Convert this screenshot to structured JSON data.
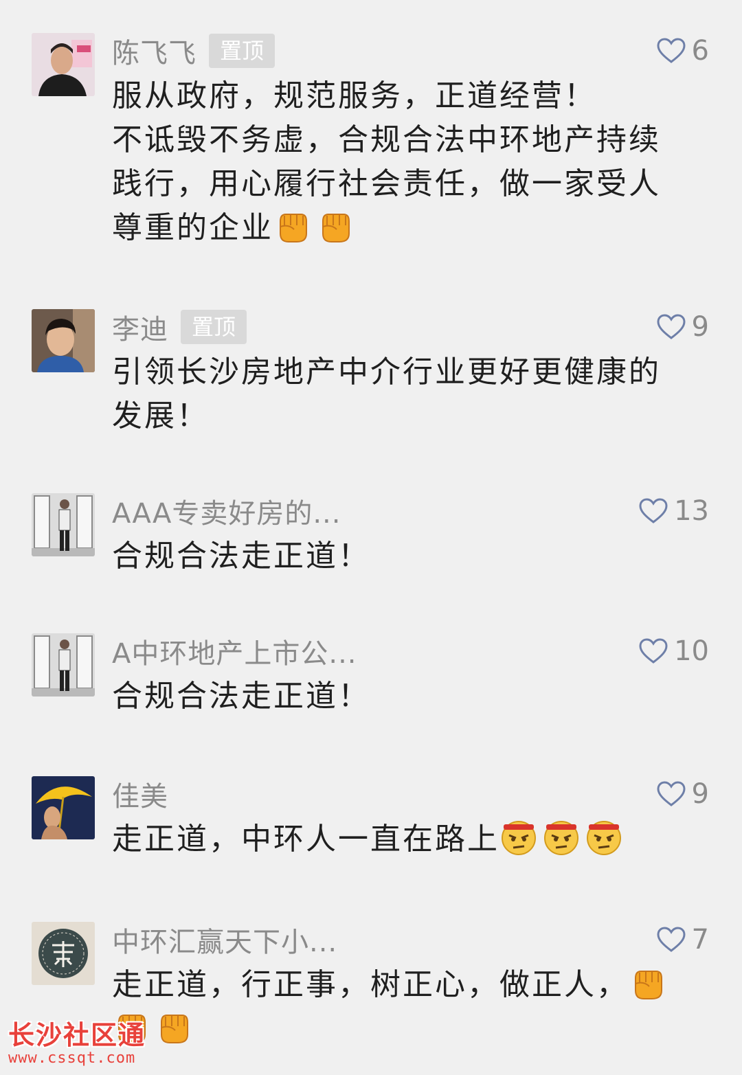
{
  "comments": [
    {
      "name": "陈飞飞",
      "pinned_label": "置顶",
      "likes": "6",
      "text": "服从政府，规范服务，正道经营！\n不诋毁不务虚，合规合法中环地产持续践行，用心履行社会责任，做一家受人尊重的企业",
      "emoji": [
        "fist-emoji",
        "fist-emoji"
      ]
    },
    {
      "name": "李迪",
      "pinned_label": "置顶",
      "likes": "9",
      "text": "引领长沙房地产中介行业更好更健康的发展！",
      "emoji": []
    },
    {
      "name": "AAA专卖好房的...",
      "likes": "13",
      "text": "合规合法走正道！",
      "emoji": []
    },
    {
      "name": "A中环地产上市公...",
      "likes": "10",
      "text": "合规合法走正道！",
      "emoji": []
    },
    {
      "name": "佳美",
      "likes": "9",
      "text": "走正道，中环人一直在路上",
      "emoji": [
        "determined-face-emoji",
        "determined-face-emoji",
        "determined-face-emoji"
      ]
    },
    {
      "name": "中环汇赢天下小...",
      "likes": "7",
      "text": "走正道，行正事，树正心，做正人，",
      "emoji": [
        "fist-emoji",
        "fist-emoji",
        "fist-emoji"
      ]
    }
  ],
  "watermark": {
    "title": "长沙社区通",
    "url": "www.cssqt.com"
  },
  "colors": {
    "background": "#f0f0f0",
    "name_text": "#8a8a8a",
    "body_text": "#1f1f1f",
    "pin_badge": "#d9d9d9",
    "watermark": "#e8413b"
  }
}
